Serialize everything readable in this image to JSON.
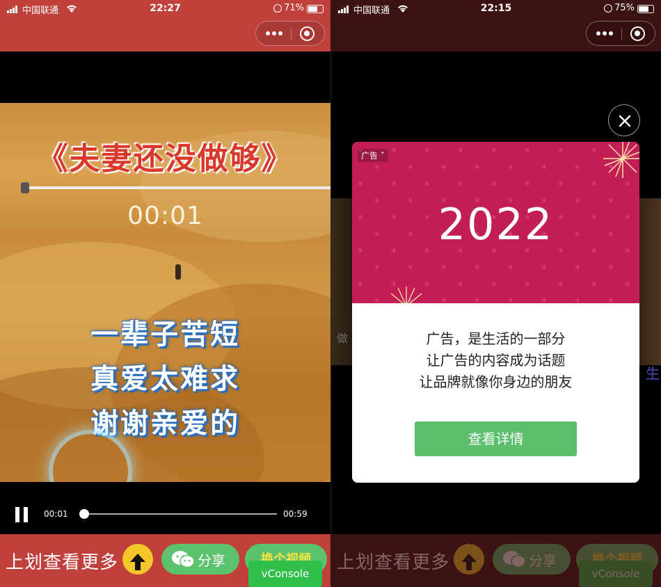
{
  "left": {
    "status": {
      "carrier": "中国联通",
      "time": "22:27",
      "battery_pct": "71%",
      "battery_level": 0.71
    },
    "video": {
      "title": "《夫妻还没做够》",
      "overlay_time": "00:01",
      "lyrics": [
        "一辈子苦短",
        "真爱太难求",
        "谢谢亲爱的"
      ]
    },
    "controls": {
      "current_time": "00:01",
      "duration": "00:59",
      "progress": 0.017
    },
    "bottom": {
      "more_label": "上划查看更多",
      "share_label": "分享",
      "swap_label": "换个视频",
      "vconsole_label": "vConsole"
    }
  },
  "right": {
    "status": {
      "carrier": "中国联通",
      "time": "22:15",
      "battery_pct": "75%",
      "battery_level": 0.75
    },
    "background_fragments": {
      "left": "做",
      "right": "生"
    },
    "ad_modal": {
      "tag": "广告",
      "year": "2022",
      "lines": [
        "广告，是生活的一部分",
        "让广告的内容成为话题",
        "让品牌就像你身边的朋友"
      ],
      "button": "查看详情"
    },
    "bottom": {
      "more_label": "上划查看更多",
      "share_label": "分享",
      "swap_label": "换个视频",
      "vconsole_label": "vConsole"
    }
  },
  "colors": {
    "header_red": "#c0413c",
    "header_dark": "#3c1212",
    "wechat_green": "#5cc26f",
    "ad_magenta": "#c41f55",
    "up_yellow": "#f3c62a"
  },
  "icons": [
    "signal-icon",
    "wifi-icon",
    "battery-icon",
    "more-dots-icon",
    "target-icon",
    "pause-icon",
    "arrow-up-icon",
    "wechat-icon",
    "close-icon",
    "chevron-down-icon"
  ]
}
